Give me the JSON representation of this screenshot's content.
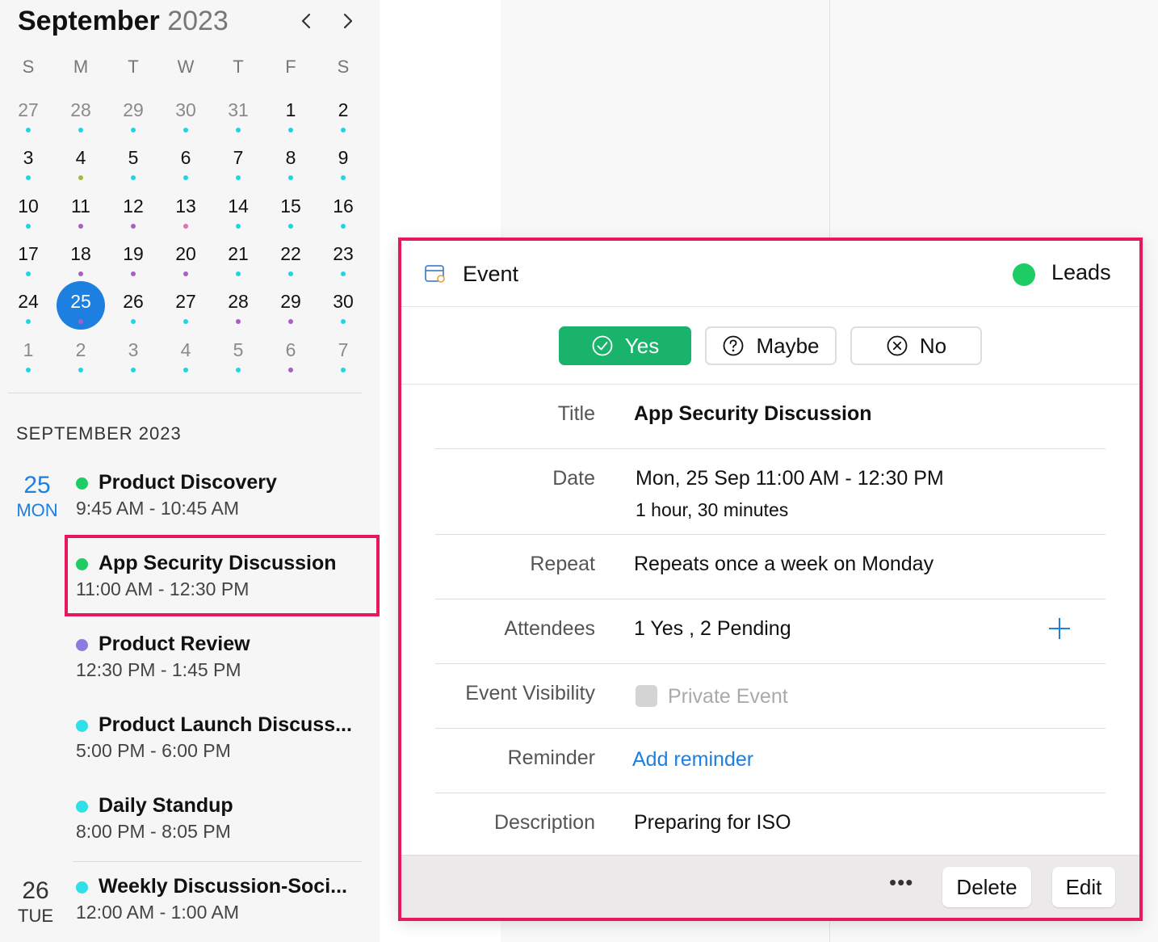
{
  "mini_calendar": {
    "month": "September",
    "year": "2023",
    "weekdays": [
      "S",
      "M",
      "T",
      "W",
      "T",
      "F",
      "S"
    ],
    "weeks": [
      [
        {
          "d": "27",
          "muted": true,
          "dot": "#1fd6e0"
        },
        {
          "d": "28",
          "muted": true,
          "dot": "#1fd6e0"
        },
        {
          "d": "29",
          "muted": true,
          "dot": "#1fd6e0"
        },
        {
          "d": "30",
          "muted": true,
          "dot": "#1fd6e0"
        },
        {
          "d": "31",
          "muted": true,
          "dot": "#1fd6e0"
        },
        {
          "d": "1",
          "dot": "#1fd6e0"
        },
        {
          "d": "2",
          "dot": "#1fd6e0"
        }
      ],
      [
        {
          "d": "3",
          "dot": "#1fd6e0"
        },
        {
          "d": "4",
          "dot": "#a6b93a"
        },
        {
          "d": "5",
          "dot": "#1fd6e0"
        },
        {
          "d": "6",
          "dot": "#1fd6e0"
        },
        {
          "d": "7",
          "dot": "#1fd6e0"
        },
        {
          "d": "8",
          "dot": "#1fd6e0"
        },
        {
          "d": "9",
          "dot": "#1fd6e0"
        }
      ],
      [
        {
          "d": "10",
          "dot": "#1fd6e0"
        },
        {
          "d": "11",
          "dot": "#a85fc0"
        },
        {
          "d": "12",
          "dot": "#a85fc0"
        },
        {
          "d": "13",
          "dot": "#e070b0"
        },
        {
          "d": "14",
          "dot": "#1fd6e0"
        },
        {
          "d": "15",
          "dot": "#1fd6e0"
        },
        {
          "d": "16",
          "dot": "#1fd6e0"
        }
      ],
      [
        {
          "d": "17",
          "dot": "#1fd6e0"
        },
        {
          "d": "18",
          "dot": "#a85fc0"
        },
        {
          "d": "19",
          "dot": "#a85fc0"
        },
        {
          "d": "20",
          "dot": "#a85fc0"
        },
        {
          "d": "21",
          "dot": "#1fd6e0"
        },
        {
          "d": "22",
          "dot": "#1fd6e0"
        },
        {
          "d": "23",
          "dot": "#1fd6e0"
        }
      ],
      [
        {
          "d": "24",
          "dot": "#1fd6e0"
        },
        {
          "d": "25",
          "dot": "#a85fc0",
          "selected": true
        },
        {
          "d": "26",
          "dot": "#1fd6e0"
        },
        {
          "d": "27",
          "dot": "#1fd6e0"
        },
        {
          "d": "28",
          "dot": "#a85fc0"
        },
        {
          "d": "29",
          "dot": "#a85fc0"
        },
        {
          "d": "30",
          "dot": "#1fd6e0"
        }
      ],
      [
        {
          "d": "1",
          "muted": true,
          "dot": "#1fd6e0"
        },
        {
          "d": "2",
          "muted": true,
          "dot": "#1fd6e0"
        },
        {
          "d": "3",
          "muted": true,
          "dot": "#1fd6e0"
        },
        {
          "d": "4",
          "muted": true,
          "dot": "#1fd6e0"
        },
        {
          "d": "5",
          "muted": true,
          "dot": "#1fd6e0"
        },
        {
          "d": "6",
          "muted": true,
          "dot": "#a85fc0"
        },
        {
          "d": "7",
          "muted": true,
          "dot": "#1fd6e0"
        }
      ]
    ],
    "selected_color": "#1d7fe0"
  },
  "agenda": {
    "month_label": "SEPTEMBER 2023",
    "day25": {
      "num": "25",
      "weekday": "MON"
    },
    "day26": {
      "num": "26",
      "weekday": "TUE"
    },
    "events": [
      {
        "title": "Product Discovery",
        "time": "9:45 AM - 10:45 AM",
        "color": "#1dcd63"
      },
      {
        "title": "App Security Discussion",
        "time": "11:00 AM - 12:30 PM",
        "color": "#1dcd63"
      },
      {
        "title": "Product Review",
        "time": "12:30 PM - 1:45 PM",
        "color": "#8a7de0"
      },
      {
        "title": "Product Launch Discuss...",
        "time": "5:00 PM - 6:00 PM",
        "color": "#2ee0e8"
      },
      {
        "title": "Daily Standup",
        "time": "8:00 PM - 8:05 PM",
        "color": "#2ee0e8"
      },
      {
        "title": "Weekly Discussion-Soci...",
        "time": "12:00 AM - 1:00 AM",
        "color": "#2ee0e8"
      }
    ]
  },
  "popover": {
    "type_label": "Event",
    "calendar_name": "Leads",
    "calendar_color": "#1dcd63",
    "rsvp": {
      "yes": "Yes",
      "maybe": "Maybe",
      "no": "No"
    },
    "fields": {
      "title_label": "Title",
      "title_value": "App Security Discussion",
      "date_label": "Date",
      "date_value": "Mon, 25 Sep  11:00 AM - 12:30 PM",
      "duration": "1 hour, 30 minutes",
      "repeat_label": "Repeat",
      "repeat_value": "Repeats once a week on Monday",
      "attendees_label": "Attendees",
      "attendees_value": "1 Yes , 2 Pending",
      "visibility_label": "Event Visibility",
      "visibility_value": "Private Event",
      "reminder_label": "Reminder",
      "reminder_value": "Add reminder",
      "description_label": "Description",
      "description_value": "Preparing for ISO"
    },
    "footer": {
      "more": "•••",
      "delete": "Delete",
      "edit": "Edit"
    }
  }
}
